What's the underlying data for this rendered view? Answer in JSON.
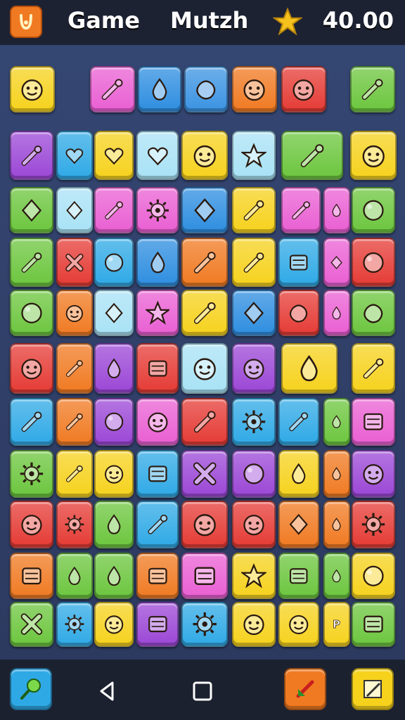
{
  "header": {
    "title_word_1": "Game",
    "title_word_2": "Mutzh",
    "score": "40.00",
    "menu_icon": "horseshoe-icon",
    "score_icon": "star-icon"
  },
  "colors": {
    "top_bar": "#1d2232",
    "board": "#2f3d64",
    "nav_bar": "#1c2130"
  },
  "board": {
    "rows": [
      [
        {
          "color": "#f6d21d",
          "icon": "face"
        },
        {
          "color": "#e95fd3",
          "icon": "tool"
        },
        {
          "color": "#2e8ee0",
          "icon": "drop"
        },
        {
          "color": "#3b93e2",
          "icon": "blob"
        },
        {
          "color": "#f07a22",
          "icon": "face"
        },
        {
          "color": "#e53b35",
          "icon": "face"
        },
        {
          "color": "#6cc63e",
          "icon": "tool"
        }
      ],
      [
        {
          "color": "#9b47d6",
          "icon": "tool"
        },
        {
          "color": "#2fa9e6",
          "icon": "heart"
        },
        {
          "color": "#f6d21d",
          "icon": "heart"
        },
        {
          "color": "#a8e2f5",
          "icon": "heart"
        },
        {
          "color": "#f6d21d",
          "icon": "face"
        },
        {
          "color": "#a8e2f5",
          "icon": "star"
        },
        {
          "color": "#6cc63e",
          "icon": "tool"
        },
        {
          "color": "#f6d21d",
          "icon": "face"
        }
      ],
      [
        {
          "color": "#6cc63e",
          "icon": "diamond"
        },
        {
          "color": "#a8e2f5",
          "icon": "diamond"
        },
        {
          "color": "#e95fd3",
          "icon": "tool"
        },
        {
          "color": "#e95fd3",
          "icon": "gear"
        },
        {
          "color": "#2e8ee0",
          "icon": "diamond"
        },
        {
          "color": "#f6d21d",
          "icon": "tool"
        },
        {
          "color": "#e95fd3",
          "icon": "tool"
        },
        {
          "color": "#e95fd3",
          "icon": "drop"
        },
        {
          "color": "#6cc63e",
          "icon": "circle"
        }
      ],
      [
        {
          "color": "#6cc63e",
          "icon": "tool"
        },
        {
          "color": "#e53b35",
          "icon": "cross"
        },
        {
          "color": "#2fa9e6",
          "icon": "circle"
        },
        {
          "color": "#2e8ee0",
          "icon": "drop"
        },
        {
          "color": "#f07a22",
          "icon": "tool"
        },
        {
          "color": "#f6d21d",
          "icon": "tool"
        },
        {
          "color": "#2fa9e6",
          "icon": "block"
        },
        {
          "color": "#e95fd3",
          "icon": "diamond"
        },
        {
          "color": "#e53b35",
          "icon": "circle"
        }
      ],
      [
        {
          "color": "#6cc63e",
          "icon": "circle"
        },
        {
          "color": "#f07a22",
          "icon": "face"
        },
        {
          "color": "#a8e2f5",
          "icon": "diamond"
        },
        {
          "color": "#e95fd3",
          "icon": "star"
        },
        {
          "color": "#f6d21d",
          "icon": "tool"
        },
        {
          "color": "#2e8ee0",
          "icon": "diamond"
        },
        {
          "color": "#e53b35",
          "icon": "blob"
        },
        {
          "color": "#e95fd3",
          "icon": "drop"
        },
        {
          "color": "#6cc63e",
          "icon": "blob"
        }
      ],
      [
        {
          "color": "#e53b35",
          "icon": "face"
        },
        {
          "color": "#f07a22",
          "icon": "tool"
        },
        {
          "color": "#9b47d6",
          "icon": "drop"
        },
        {
          "color": "#e53b35",
          "icon": "block"
        },
        {
          "color": "#a8e2f5",
          "icon": "face"
        },
        {
          "color": "#9b47d6",
          "icon": "face"
        },
        {
          "color": "#f6d21d",
          "icon": "drop"
        },
        {
          "color": "#f6d21d",
          "icon": "tool"
        }
      ],
      [
        {
          "color": "#2fa9e6",
          "icon": "tool"
        },
        {
          "color": "#f07a22",
          "icon": "tool"
        },
        {
          "color": "#9b47d6",
          "icon": "circle"
        },
        {
          "color": "#e95fd3",
          "icon": "face"
        },
        {
          "color": "#e53b35",
          "icon": "tool"
        },
        {
          "color": "#2fa9e6",
          "icon": "gear"
        },
        {
          "color": "#2fa9e6",
          "icon": "tool"
        },
        {
          "color": "#6cc63e",
          "icon": "drop"
        },
        {
          "color": "#e95fd3",
          "icon": "block"
        }
      ],
      [
        {
          "color": "#6cc63e",
          "icon": "gear"
        },
        {
          "color": "#f6d21d",
          "icon": "tool"
        },
        {
          "color": "#f6d21d",
          "icon": "face"
        },
        {
          "color": "#2fa9e6",
          "icon": "block"
        },
        {
          "color": "#9b47d6",
          "icon": "cross"
        },
        {
          "color": "#9b47d6",
          "icon": "circle"
        },
        {
          "color": "#f6d21d",
          "icon": "drop"
        },
        {
          "color": "#f07a22",
          "icon": "drop"
        },
        {
          "color": "#9b47d6",
          "icon": "face"
        }
      ],
      [
        {
          "color": "#e53b35",
          "icon": "face"
        },
        {
          "color": "#e53b35",
          "icon": "gear"
        },
        {
          "color": "#6cc63e",
          "icon": "drop"
        },
        {
          "color": "#2fa9e6",
          "icon": "tool"
        },
        {
          "color": "#e53b35",
          "icon": "face"
        },
        {
          "color": "#e53b35",
          "icon": "face"
        },
        {
          "color": "#f07a22",
          "icon": "diamond"
        },
        {
          "color": "#f07a22",
          "icon": "drop"
        },
        {
          "color": "#e53b35",
          "icon": "gear"
        }
      ],
      [
        {
          "color": "#f07a22",
          "icon": "block"
        },
        {
          "color": "#6cc63e",
          "icon": "drop"
        },
        {
          "color": "#6cc63e",
          "icon": "drop"
        },
        {
          "color": "#f07a22",
          "icon": "block"
        },
        {
          "color": "#e95fd3",
          "icon": "block"
        },
        {
          "color": "#f6d21d",
          "icon": "star"
        },
        {
          "color": "#6cc63e",
          "icon": "block"
        },
        {
          "color": "#6cc63e",
          "icon": "drop"
        },
        {
          "color": "#f6d21d",
          "icon": "circle"
        }
      ],
      [
        {
          "color": "#6cc63e",
          "icon": "cross"
        },
        {
          "color": "#2fa9e6",
          "icon": "gear"
        },
        {
          "color": "#f6d21d",
          "icon": "face"
        },
        {
          "color": "#9b47d6",
          "icon": "block"
        },
        {
          "color": "#2fa9e6",
          "icon": "gear"
        },
        {
          "color": "#f6d21d",
          "icon": "face"
        },
        {
          "color": "#f6d21d",
          "icon": "face"
        },
        {
          "color": "#f6d21d",
          "icon": "letter",
          "glyph": "P"
        },
        {
          "color": "#6cc63e",
          "icon": "block"
        }
      ]
    ]
  },
  "bottom_bar": {
    "left_tile": {
      "color": "#2fa9e6",
      "icon": "racket-icon"
    },
    "back_icon": "triangle-back-icon",
    "home_icon": "square-home-icon",
    "right_tile_1": {
      "color": "#f07a22",
      "icon": "arrow-icon"
    },
    "right_tile_2": {
      "color": "#f6d21d",
      "icon": "pencil-icon"
    }
  }
}
